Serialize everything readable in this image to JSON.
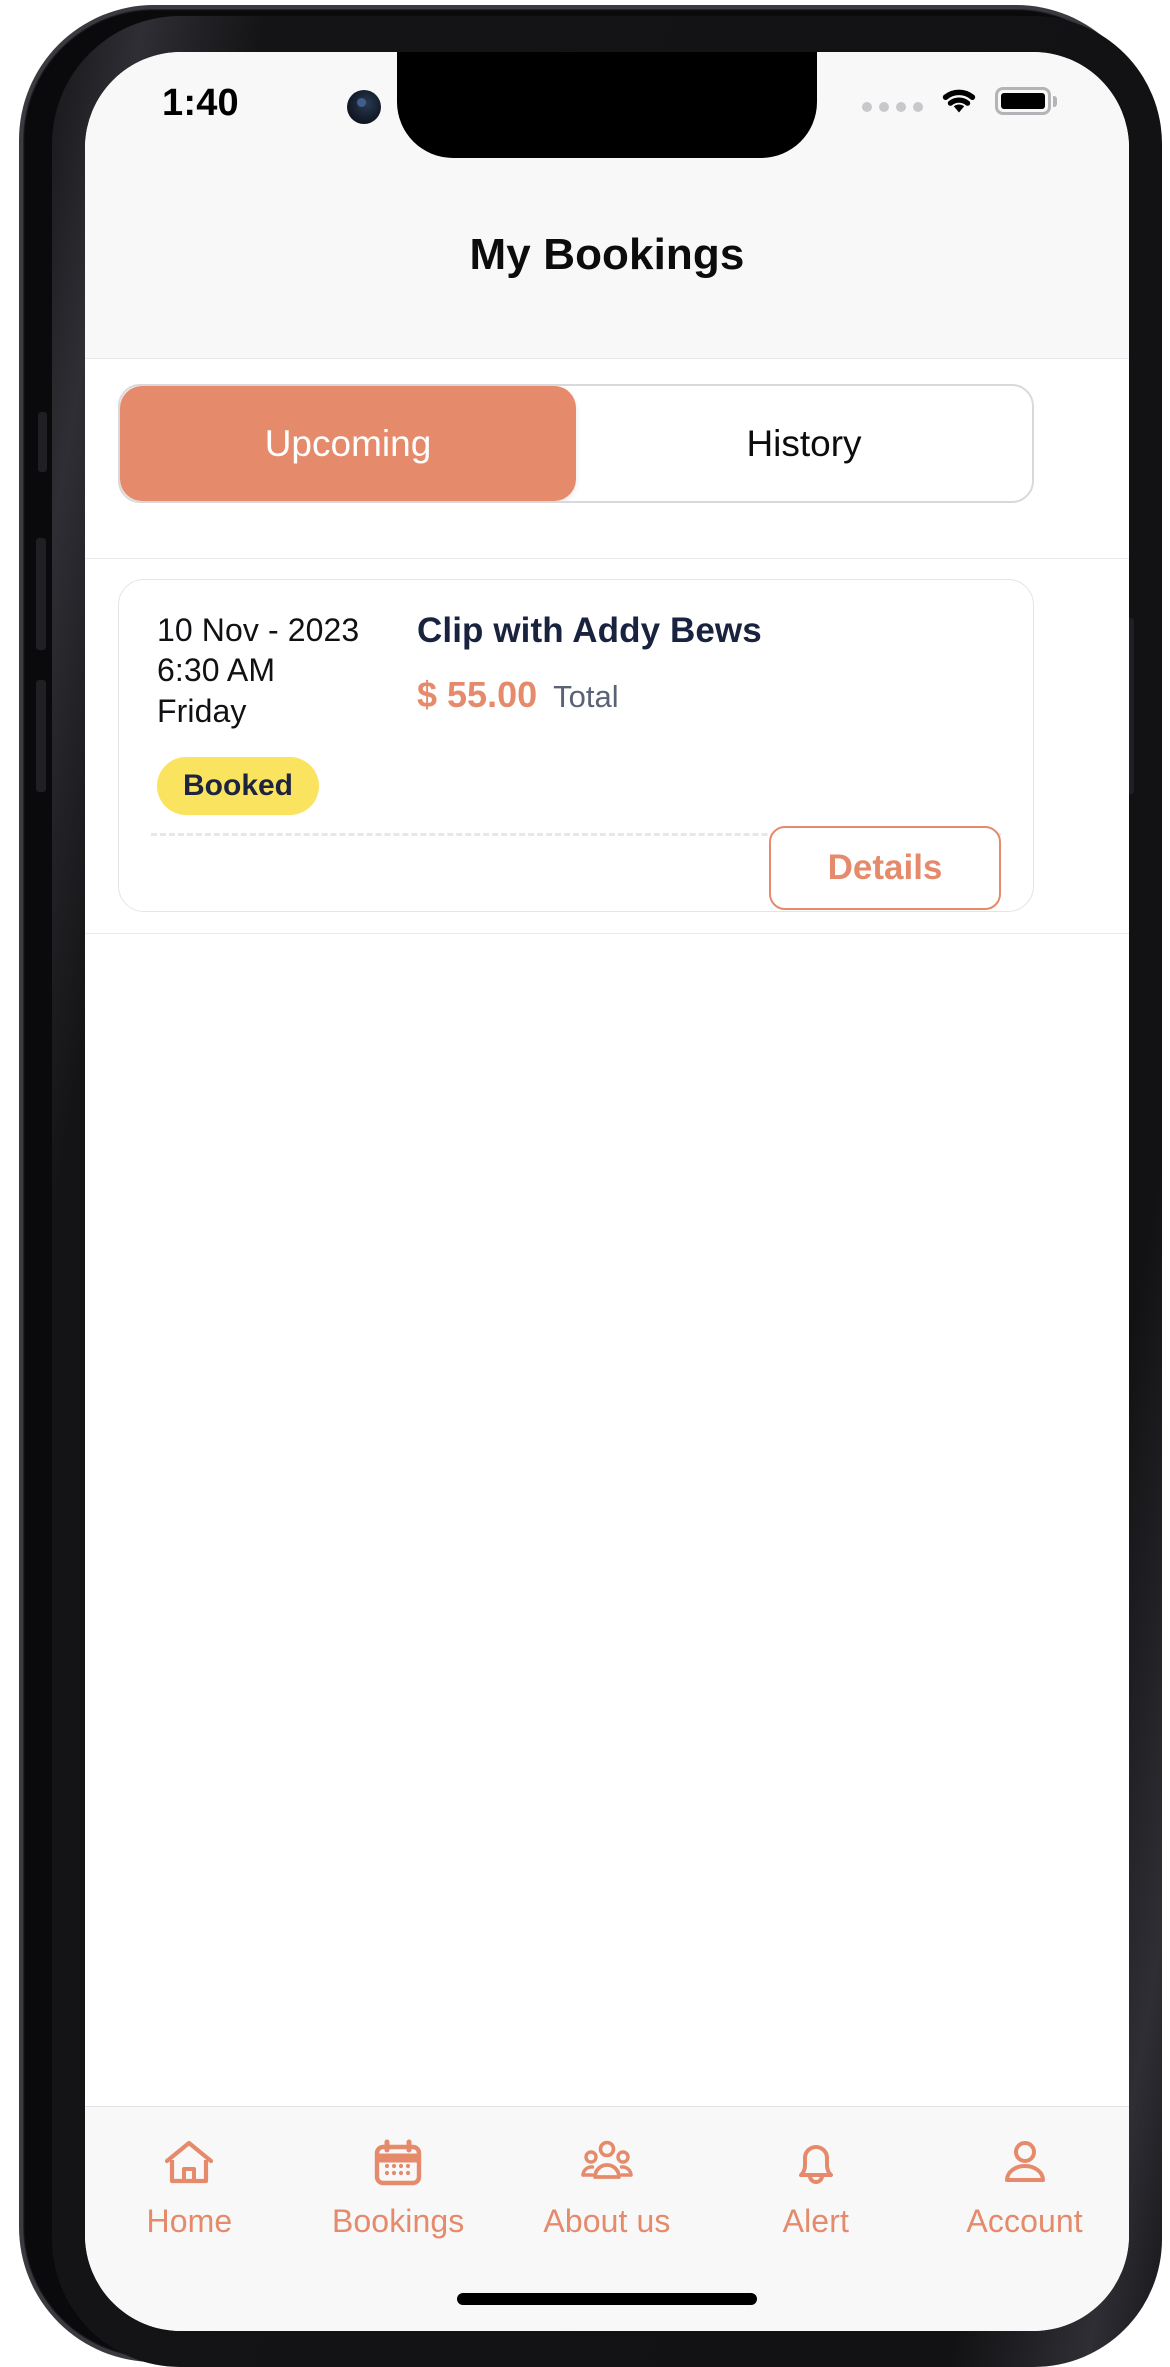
{
  "status_bar": {
    "time": "1:40",
    "signal_icon": "signal-dots-icon",
    "wifi_icon": "wifi-icon",
    "battery_icon": "battery-full-icon"
  },
  "header": {
    "title": "My Bookings"
  },
  "tabs": [
    {
      "label": "Upcoming",
      "active": true
    },
    {
      "label": "History",
      "active": false
    }
  ],
  "booking": {
    "date": "10 Nov - 2023",
    "time": "6:30 AM",
    "day": "Friday",
    "service_title": "Clip with Addy Bews",
    "price": "$ 55.00",
    "price_label": "Total",
    "status": "Booked",
    "details_label": "Details"
  },
  "bottom_nav": [
    {
      "label": "Home",
      "icon": "home-icon"
    },
    {
      "label": "Bookings",
      "icon": "calendar-icon"
    },
    {
      "label": "About us",
      "icon": "people-group-icon"
    },
    {
      "label": "Alert",
      "icon": "bell-icon"
    },
    {
      "label": "Account",
      "icon": "person-icon"
    }
  ],
  "colors": {
    "accent": "#e58a6b",
    "badge_bg": "#fae45f",
    "badge_text": "#1d2440",
    "title_navy": "#192340",
    "muted": "#5a6375"
  }
}
